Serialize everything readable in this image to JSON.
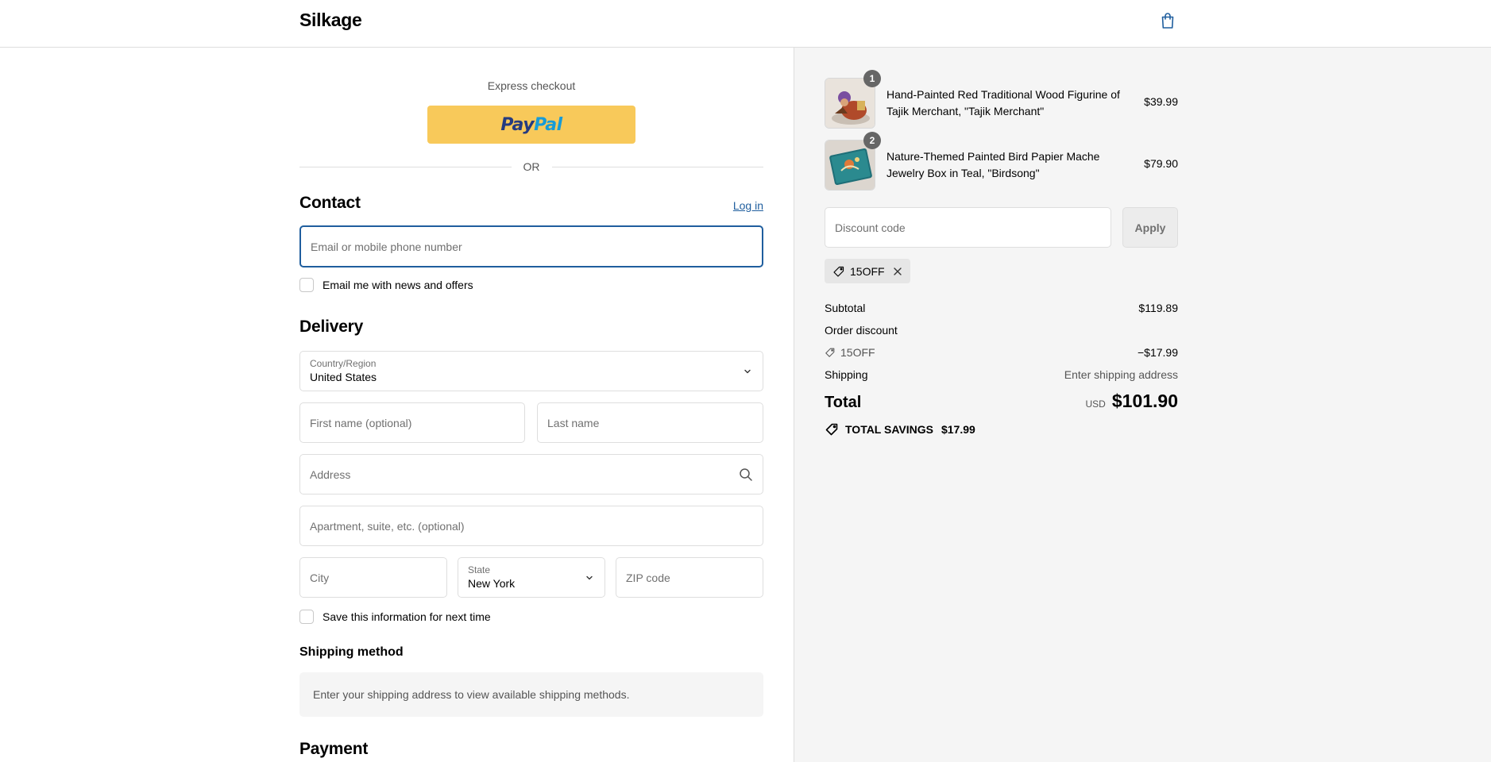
{
  "header": {
    "brand": "Silkage",
    "cart_icon": "shopping-bag-icon"
  },
  "express": {
    "label": "Express checkout",
    "paypal_part1": "Pay",
    "paypal_part2": "Pal",
    "or_text": "OR"
  },
  "contact": {
    "title": "Contact",
    "login_label": "Log in",
    "email_placeholder": "Email or mobile phone number",
    "email_value": "",
    "newsletter_label": "Email me with news and offers"
  },
  "delivery": {
    "title": "Delivery",
    "country_label": "Country/Region",
    "country_value": "United States",
    "first_name_placeholder": "First name (optional)",
    "last_name_placeholder": "Last name",
    "address_placeholder": "Address",
    "apartment_placeholder": "Apartment, suite, etc. (optional)",
    "city_placeholder": "City",
    "state_label": "State",
    "state_value": "New York",
    "zip_placeholder": "ZIP code",
    "save_info_label": "Save this information for next time"
  },
  "shipping_method": {
    "title": "Shipping method",
    "message": "Enter your shipping address to view available shipping methods."
  },
  "payment": {
    "title": "Payment"
  },
  "summary": {
    "items": [
      {
        "quantity": "1",
        "name": "Hand-Painted Red Traditional Wood Figurine of Tajik Merchant, \"Tajik Merchant\"",
        "price": "$39.99"
      },
      {
        "quantity": "2",
        "name": "Nature-Themed Painted Bird Papier Mache Jewelry Box in Teal, \"Birdsong\"",
        "price": "$79.90"
      }
    ],
    "discount_placeholder": "Discount code",
    "apply_label": "Apply",
    "applied_code": "15OFF",
    "subtotal_label": "Subtotal",
    "subtotal_value": "$119.89",
    "order_discount_label": "Order discount",
    "discount_code_label": "15OFF",
    "discount_value": "−$17.99",
    "shipping_label": "Shipping",
    "shipping_value": "Enter shipping address",
    "total_label": "Total",
    "total_currency": "USD",
    "total_value": "$101.90",
    "savings_label": "TOTAL SAVINGS",
    "savings_value": "$17.99"
  },
  "colors": {
    "accent": "#1f5e9e",
    "paypal_yellow": "#f8c95a",
    "summary_bg": "#f5f5f5"
  }
}
